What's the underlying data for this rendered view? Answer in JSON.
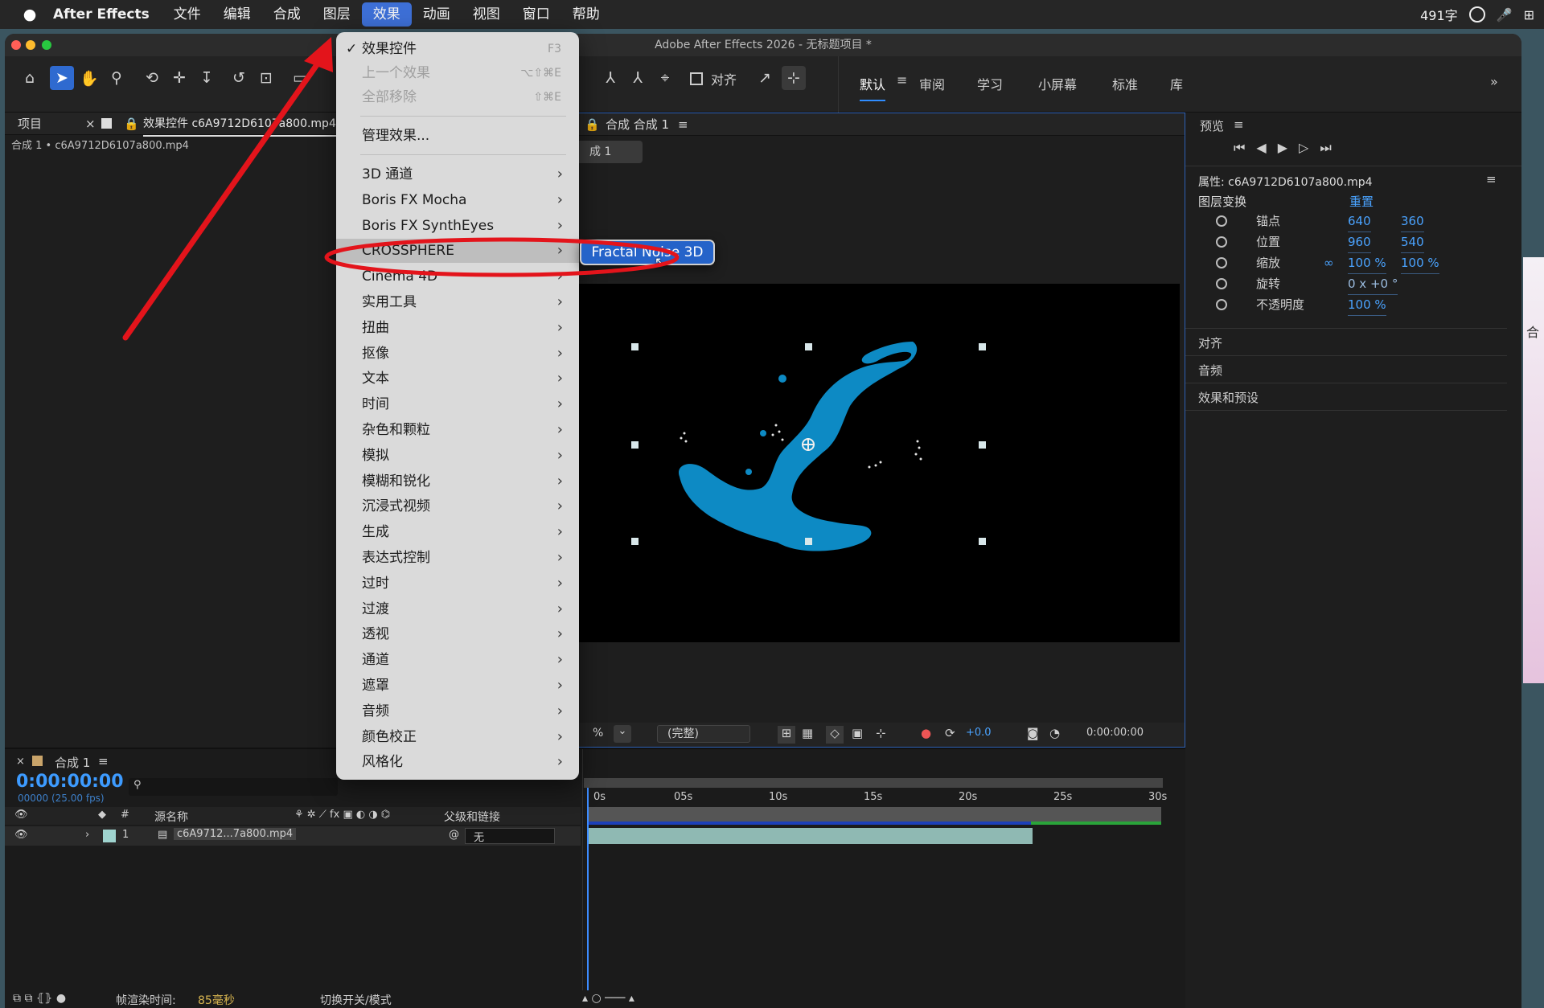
{
  "menubar": {
    "app": "After Effects",
    "items": [
      "文件",
      "编辑",
      "合成",
      "图层",
      "效果",
      "动画",
      "视图",
      "窗口",
      "帮助"
    ],
    "active": "效果",
    "word_count": "491字"
  },
  "window": {
    "title": "Adobe After Effects 2026 - 无标题项目 *"
  },
  "toolbar": {
    "align_label": "对齐"
  },
  "workspaces": [
    "默认",
    "审阅",
    "学习",
    "小屏幕",
    "标准",
    "库"
  ],
  "project": {
    "tab_label": "项目",
    "effect_controls_label": "效果控件 c6A9712D6107a800.mp4",
    "breadcrumb": "合成 1 • c6A9712D6107a800.mp4"
  },
  "comp": {
    "tab_label": "合成 合成 1",
    "flow_label": "成 1",
    "zoom_suffix": "%",
    "resolution": "(完整)",
    "exposure": "+0.0",
    "timecode": "0:00:00:00"
  },
  "preview": {
    "title": "预览"
  },
  "properties": {
    "title": "属性: c6A9712D6107a800.mp4",
    "section": "图层变换",
    "reset": "重置",
    "rows": [
      {
        "name": "锚点",
        "v1": "640",
        "v2": "360"
      },
      {
        "name": "位置",
        "v1": "960",
        "v2": "540"
      },
      {
        "name": "缩放",
        "v1": "100 %",
        "v2": "100 %"
      },
      {
        "name": "旋转",
        "v1": "0 x +0 °",
        "v2": ""
      },
      {
        "name": "不透明度",
        "v1": "100 %",
        "v2": ""
      }
    ],
    "panels": [
      "对齐",
      "音频",
      "效果和预设"
    ]
  },
  "effects_menu": {
    "top": [
      {
        "label": "效果控件",
        "shortcut": "F3",
        "checked": true,
        "disabled": false
      },
      {
        "label": "上一个效果",
        "shortcut": "⌥⇧⌘E",
        "disabled": true
      },
      {
        "label": "全部移除",
        "shortcut": "⇧⌘E",
        "disabled": true
      }
    ],
    "manage": "管理效果...",
    "categories": [
      "3D 通道",
      "Boris FX Mocha",
      "Boris FX SynthEyes",
      "CROSSPHERE",
      "Cinema 4D",
      "实用工具",
      "扭曲",
      "抠像",
      "文本",
      "时间",
      "杂色和颗粒",
      "模拟",
      "模糊和锐化",
      "沉浸式视频",
      "生成",
      "表达式控制",
      "过时",
      "过渡",
      "透视",
      "通道",
      "遮罩",
      "音频",
      "颜色校正",
      "风格化"
    ],
    "highlighted": "CROSSPHERE",
    "submenu": [
      "Fractal Noise 3D"
    ]
  },
  "timeline": {
    "tab_label": "合成 1",
    "timecode": "0:00:00:00",
    "fps": "00000 (25.00 fps)",
    "col_name": "源名称",
    "col_parent": "父级和链接",
    "layer_num": "1",
    "layer_name": "c6A9712...7a800.mp4",
    "parent_value": "无",
    "ruler": [
      "0s",
      "05s",
      "10s",
      "15s",
      "20s",
      "25s",
      "30s"
    ]
  },
  "statusbar": {
    "render_label": "帧渲染时间:",
    "render_value": "85毫秒",
    "toggle_label": "切换开关/模式"
  },
  "edge": {
    "char": "合"
  }
}
